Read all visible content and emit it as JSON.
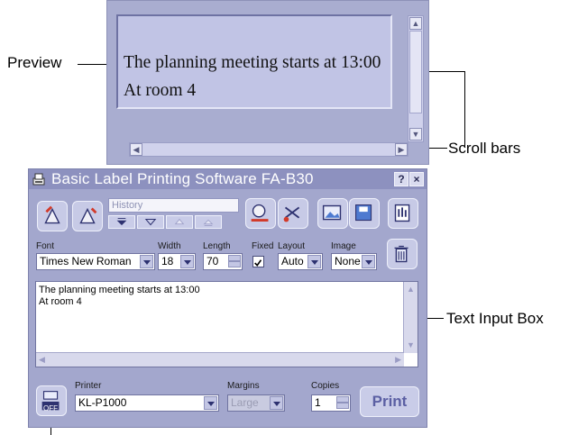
{
  "callouts": {
    "preview": "Preview",
    "scroll_bars": "Scroll bars",
    "text_input_box": "Text Input Box"
  },
  "preview": {
    "line1": "The planning meeting starts at 13:00",
    "line2": "At room 4"
  },
  "window": {
    "title": "Basic Label Printing Software FA-B30",
    "help_button": "?",
    "close_button": "×"
  },
  "toolbar": {
    "history_placeholder": "History"
  },
  "controls": {
    "font_label": "Font",
    "font_value": "Times New Roman",
    "width_label": "Width",
    "width_value": "18",
    "length_label": "Length",
    "length_value": "70",
    "fixed_label": "Fixed",
    "fixed_checked": true,
    "layout_label": "Layout",
    "layout_value": "Auto",
    "image_label": "Image",
    "image_value": "None"
  },
  "text_input": {
    "line1": "The planning meeting starts at 13:00",
    "line2": "At room 4"
  },
  "bottom": {
    "power_label": "OFF",
    "printer_label": "Printer",
    "printer_value": "KL-P1000",
    "margins_label": "Margins",
    "margins_value": "Large",
    "copies_label": "Copies",
    "copies_value": "1",
    "print_label": "Print"
  },
  "colors": {
    "window_bg": "#a3a7cd",
    "titlebar": "#8d91bf",
    "preview_label": "#c1c4e5",
    "accent": "#5b5fa3"
  }
}
